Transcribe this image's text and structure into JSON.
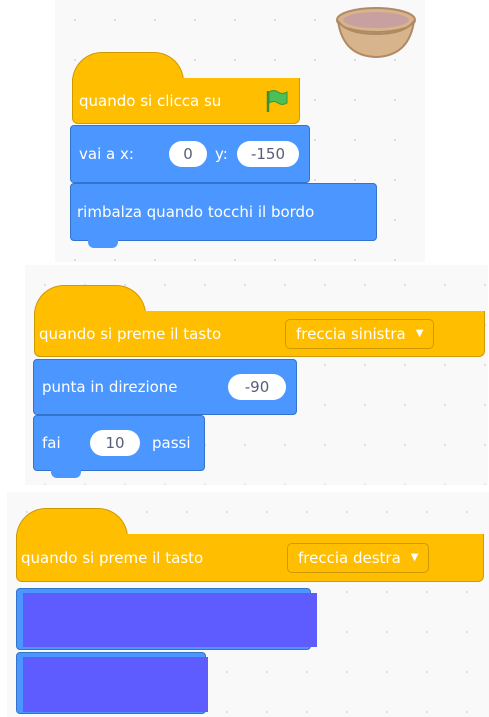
{
  "script1": {
    "hat": {
      "text": "quando si clicca su",
      "icon": "green-flag-icon"
    },
    "goto": {
      "prefix": "vai a x:",
      "x": "0",
      "ylabel": "y:",
      "y": "-150"
    },
    "bounce": {
      "text": "rimbalza quando tocchi il bordo"
    }
  },
  "script2": {
    "hat": {
      "text": "quando si preme il tasto",
      "key": "freccia sinistra"
    },
    "point": {
      "text": "punta in direzione",
      "value": "-90"
    },
    "move": {
      "prefix": "fai",
      "value": "10",
      "suffix": "passi"
    }
  },
  "script3": {
    "hat": {
      "text": "quando si preme il tasto",
      "key": "freccia destra"
    }
  },
  "colors": {
    "events": "#ffbf00",
    "motion": "#4c97ff",
    "redaction": "#5e5cff"
  }
}
